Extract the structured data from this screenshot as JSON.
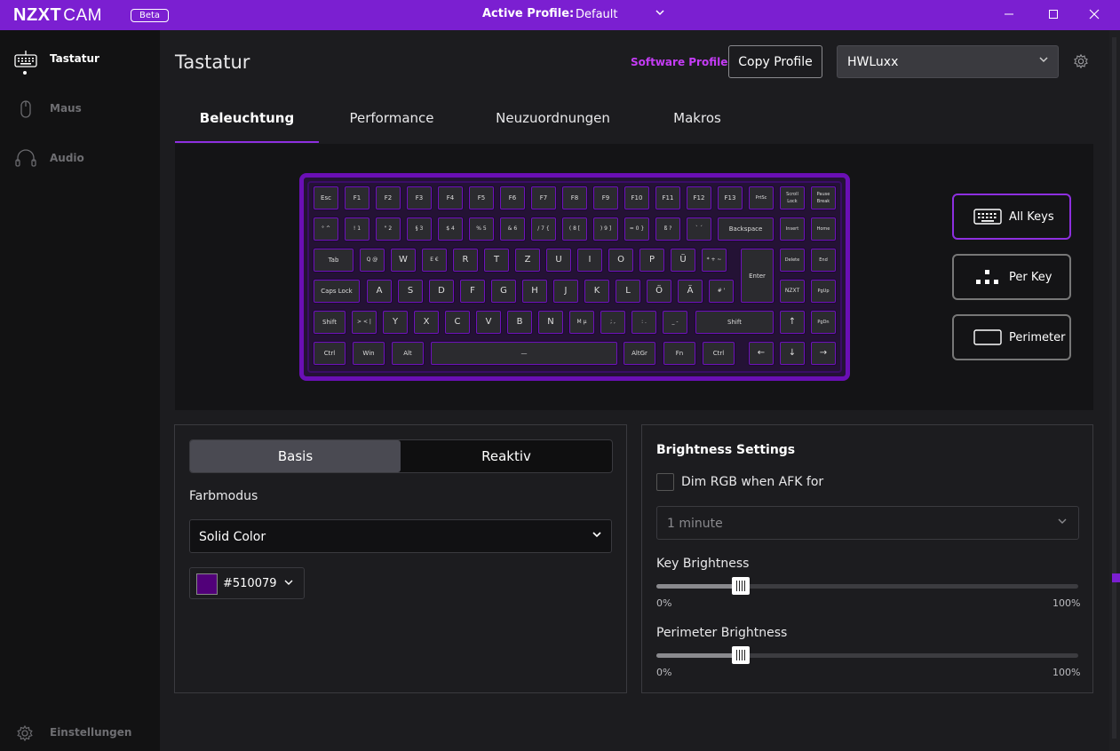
{
  "app": {
    "logo": "NZXT",
    "logo_cam": "CAM",
    "beta": "Beta",
    "active_profile_label": "Active Profile:",
    "active_profile_value": "Default"
  },
  "sidebar": {
    "items": [
      {
        "label": "Tastatur",
        "icon": "keyboard-icon"
      },
      {
        "label": "Maus",
        "icon": "mouse-icon"
      },
      {
        "label": "Audio",
        "icon": "headset-icon"
      }
    ],
    "settings_label": "Einstellungen"
  },
  "header": {
    "title": "Tastatur",
    "software_profile": "Software Profile",
    "copy_profile": "Copy Profile",
    "device_select": "HWLuxx"
  },
  "tabs": [
    {
      "label": "Beleuchtung",
      "active": true
    },
    {
      "label": "Performance",
      "active": false
    },
    {
      "label": "Neuzuordnungen",
      "active": false
    },
    {
      "label": "Makros",
      "active": false
    }
  ],
  "keyboard": {
    "rows": [
      [
        "Esc",
        "F1",
        "F2",
        "F3",
        "F4",
        "F5",
        "F6",
        "F7",
        "F8",
        "F9",
        "F10",
        "F11",
        "F12",
        "F13",
        "PrtSc",
        "Scroll Lock",
        "Pause Break"
      ],
      [
        "° ^",
        "! 1",
        "\" 2",
        "§ 3",
        "$ 4",
        "% 5",
        "& 6",
        "/ 7 {",
        "( 8 [",
        ") 9 ]",
        "= 0 }",
        "ß ?",
        "` ´",
        "Backspace",
        "Insert",
        "Home"
      ],
      [
        "Tab",
        "Q @",
        "W",
        "E €",
        "R",
        "T",
        "Z",
        "U",
        "I",
        "O",
        "P",
        "Ü",
        "* + ~",
        "Enter",
        "Delete",
        "End"
      ],
      [
        "Caps Lock",
        "A",
        "S",
        "D",
        "F",
        "G",
        "H",
        "J",
        "K",
        "L",
        "Ö",
        "Ä",
        "# '",
        "NZXT",
        "PgUp"
      ],
      [
        "Shift",
        "> < |",
        "Y",
        "X",
        "C",
        "V",
        "B",
        "N",
        "M µ",
        ";  ,",
        ":  .",
        "_  -",
        "Shift",
        "↑",
        "PgDn"
      ],
      [
        "Ctrl",
        "Win",
        "Alt",
        "—",
        "AltGr",
        "Fn",
        "Ctrl",
        "←",
        "↓",
        "→"
      ]
    ]
  },
  "modes": [
    {
      "label": "All Keys",
      "selected": true
    },
    {
      "label": "Per Key",
      "selected": false
    },
    {
      "label": "Perimeter",
      "selected": false
    }
  ],
  "color_panel": {
    "seg_basis": "Basis",
    "seg_reaktiv": "Reaktiv",
    "farbmodus_label": "Farbmodus",
    "farbmodus_value": "Solid Color",
    "color_hex": "#510079"
  },
  "brightness": {
    "title": "Brightness Settings",
    "dim_label": "Dim RGB when AFK for",
    "dim_checked": false,
    "afk_value": "1 minute",
    "key_label": "Key Brightness",
    "key_value": 0.2,
    "perimeter_label": "Perimeter Brightness",
    "perimeter_value": 0.2,
    "min": "0%",
    "max": "100%"
  },
  "colors": {
    "accent": "#7b1fd1",
    "keyboard_glow": "#6a0fb5",
    "swatch": "#510079"
  }
}
